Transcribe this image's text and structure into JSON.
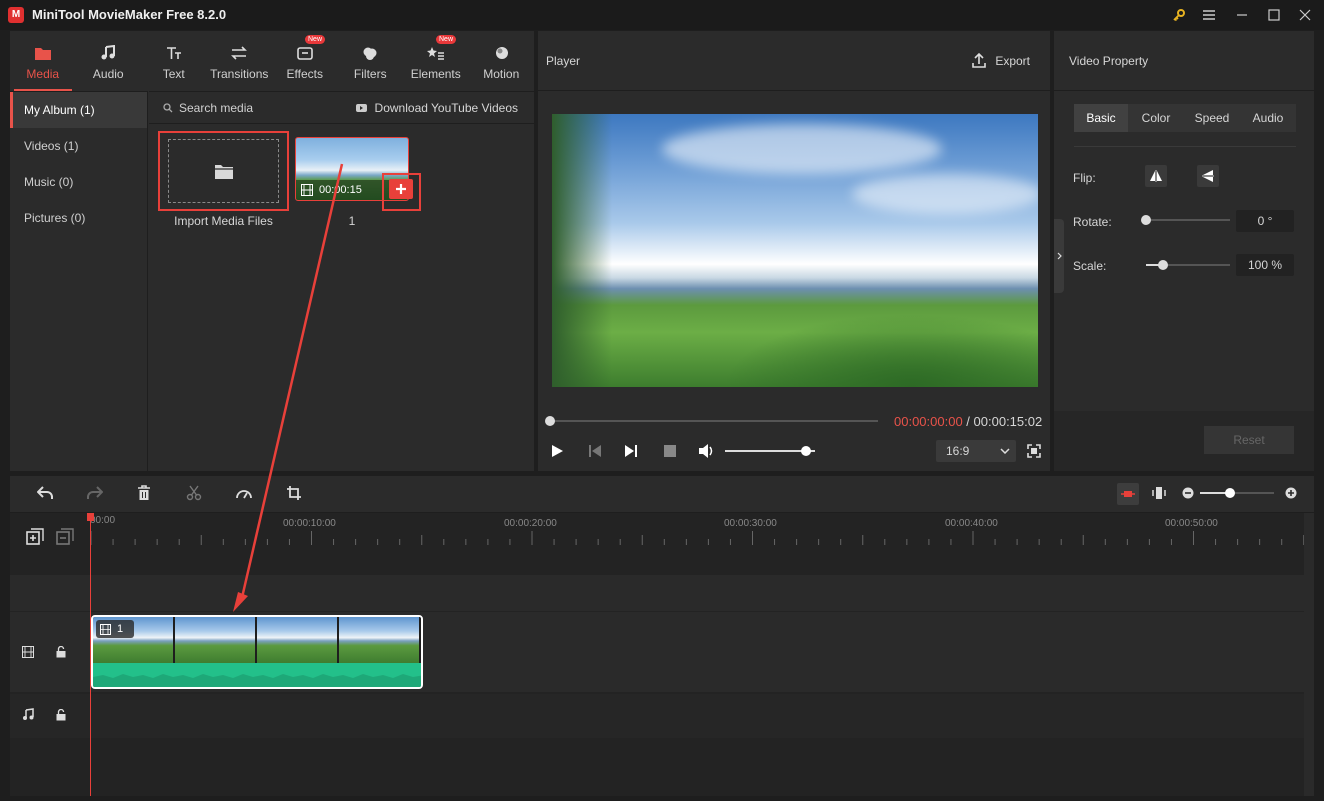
{
  "app": {
    "title": "MiniTool MovieMaker Free 8.2.0",
    "logo_text": "M"
  },
  "toolbar": {
    "tabs": [
      {
        "label": "Media",
        "icon": "folder-icon",
        "active": true
      },
      {
        "label": "Audio",
        "icon": "music-note-icon"
      },
      {
        "label": "Text",
        "icon": "text-icon"
      },
      {
        "label": "Transitions",
        "icon": "transitions-icon"
      },
      {
        "label": "Effects",
        "icon": "effects-icon",
        "badge": "New"
      },
      {
        "label": "Filters",
        "icon": "filters-icon"
      },
      {
        "label": "Elements",
        "icon": "elements-icon",
        "badge": "New"
      },
      {
        "label": "Motion",
        "icon": "motion-icon"
      }
    ]
  },
  "album": {
    "items": [
      {
        "label": "My Album (1)",
        "active": true
      },
      {
        "label": "Videos (1)"
      },
      {
        "label": "Music (0)"
      },
      {
        "label": "Pictures (0)"
      }
    ]
  },
  "media": {
    "search_placeholder": "Search media",
    "download_label": "Download YouTube Videos",
    "import_label": "Import Media Files",
    "clip_duration": "00:00:15",
    "clip_name": "1"
  },
  "player": {
    "title": "Player",
    "export_label": "Export",
    "current_time": "00:00:00:00",
    "separator": " / ",
    "total_time": "00:00:15:02",
    "aspect_ratio": "16:9",
    "volume_level": 0.9,
    "progress": 0.0
  },
  "property": {
    "title": "Video Property",
    "tabs": [
      "Basic",
      "Color",
      "Speed",
      "Audio"
    ],
    "active_tab": "Basic",
    "flip_label": "Flip:",
    "rotate_label": "Rotate:",
    "rotate_value": "0 °",
    "rotate_level": 0.0,
    "scale_label": "Scale:",
    "scale_value": "100 %",
    "scale_level": 0.2,
    "reset_label": "Reset"
  },
  "timeline": {
    "ticks": [
      "00:00",
      "00:00:10:00",
      "00:00:20:00",
      "00:00:30:00",
      "00:00:40:00",
      "00:00:50:00"
    ],
    "clip_label": "1",
    "zoom_level": 0.4
  },
  "colors": {
    "accent": "#e8534a",
    "audio_wave": "#23c08a",
    "panel": "#2b2b2b"
  }
}
